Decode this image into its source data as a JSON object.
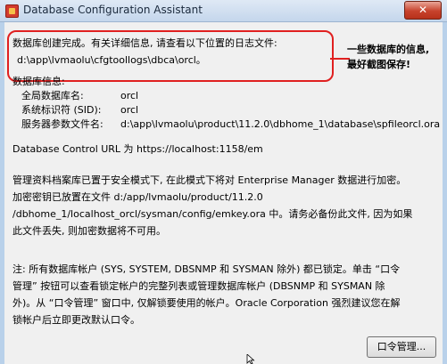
{
  "window": {
    "title": "Database Configuration Assistant",
    "close_glyph": "✕"
  },
  "completion": {
    "line1": "数据库创建完成。有关详细信息, 请查看以下位置的日志文件:",
    "line2": "d:\\app\\lvmaolu\\cfgtoollogs\\dbca\\orcl。"
  },
  "annotation": {
    "line1": "一些数据库的信息,",
    "line2": "最好截图保存!"
  },
  "db_info": {
    "heading": "数据库信息:",
    "rows": [
      {
        "label": "全局数据库名:",
        "value": "orcl"
      },
      {
        "label": "系统标识符 (SID):",
        "value": "orcl"
      },
      {
        "label": "服务器参数文件名:",
        "value": "d:\\app\\lvmaolu\\product\\11.2.0\\dbhome_1\\database\\spfileorcl.ora"
      }
    ]
  },
  "dbcontrol": "Database Control URL 为 https://localhost:1158/em",
  "repository_note": [
    "管理资料档案库已置于安全模式下, 在此模式下将对 Enterprise Manager 数据进行加密。",
    "加密密钥已放置在文件 d:/app/lvmaolu/product/11.2.0",
    "/dbhome_1/localhost_orcl/sysman/config/emkey.ora 中。请务必备份此文件, 因为如果",
    "此文件丢失, 则加密数据将不可用。"
  ],
  "accounts_note": [
    "注: 所有数据库帐户 (SYS, SYSTEM, DBSNMP 和 SYSMAN 除外) 都已锁定。单击 “口令",
    "管理” 按钮可以查看锁定帐户的完整列表或管理数据库帐户 (DBSNMP 和 SYSMAN 除",
    "外)。从 “口令管理” 窗口中, 仅解锁要使用的帐户。Oracle Corporation 强烈建议您在解",
    "锁帐户后立即更改默认口令。"
  ],
  "buttons": {
    "password_management": "口令管理..."
  },
  "colors": {
    "highlight": "#e02020",
    "window_frame": "#b9d1ea",
    "panel": "#f0f0f0"
  }
}
